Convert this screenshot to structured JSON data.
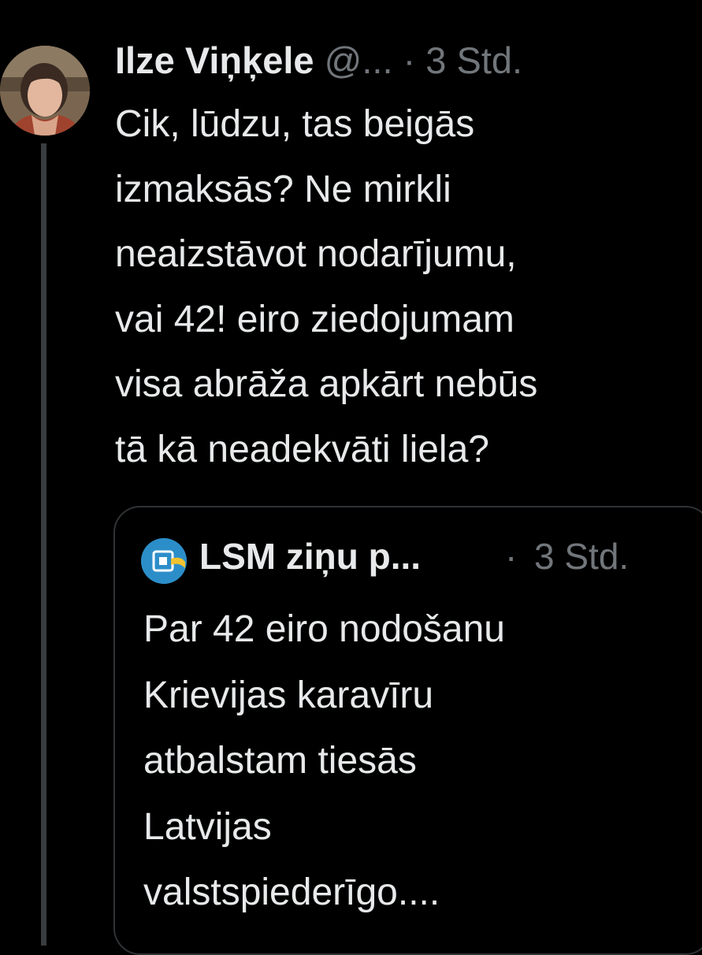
{
  "tweet": {
    "author_name": "Ilze Viņķele",
    "author_handle": "@...",
    "separator": "·",
    "time": "3 Std.",
    "body_lines": [
      "Cik, lūdzu, tas  beigās",
      "izmaksās? Ne mirkli",
      "neaizstāvot nodarījumu,",
      "vai 42! eiro ziedojumam",
      "visa abrāža apkārt nebūs",
      "tā kā neadekvāti liela?"
    ]
  },
  "quoted_tweet": {
    "author_name": "LSM ziņu p...",
    "separator": "·",
    "time": "3 Std.",
    "body_lines": [
      "Par 42 eiro nodošanu",
      "Krievijas karavīru",
      "atbalstam tiesās",
      "Latvijas",
      "valstspiederīgo...."
    ]
  },
  "colors": {
    "background": "#000000",
    "primary_text": "#e7e9ea",
    "secondary_text": "#71767b",
    "border": "#2f3336",
    "lsm_blue": "#2c8ec9"
  },
  "icons": {
    "author_avatar": "user-avatar-photo",
    "quote_avatar": "lsm-logo-icon"
  }
}
